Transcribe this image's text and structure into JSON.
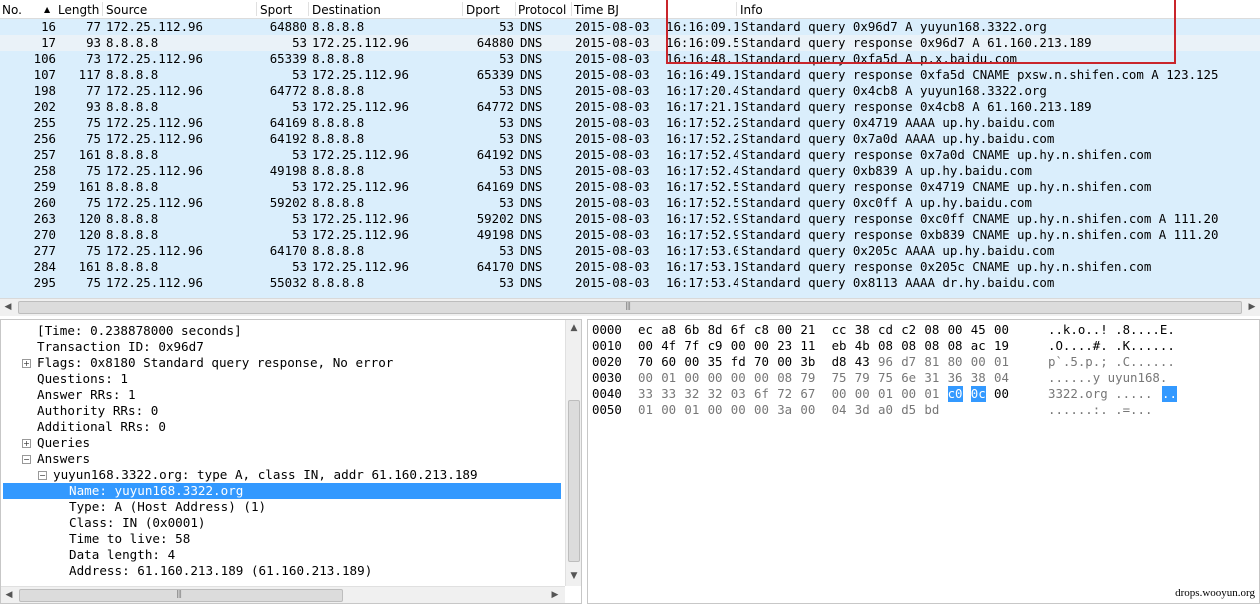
{
  "columns": [
    "No.",
    "Length",
    "Source",
    "Sport",
    "Destination",
    "Dport",
    "Protocol",
    "Time BJ",
    "Info"
  ],
  "packets": [
    {
      "no": "16",
      "len": "77",
      "src": "172.25.112.96",
      "sport": "64880",
      "dst": "8.8.8.8",
      "dport": "53",
      "proto": "DNS",
      "date": "2015-08-03",
      "time": "16:16:09.1",
      "info": "Standard query 0x96d7  A yuyun168.3322.org"
    },
    {
      "no": "17",
      "len": "93",
      "src": "8.8.8.8",
      "sport": "53",
      "dst": "172.25.112.96",
      "dport": "64880",
      "proto": "DNS",
      "date": "2015-08-03",
      "time": "16:16:09.5",
      "info": "Standard query response 0x96d7  A 61.160.213.189",
      "selected": true
    },
    {
      "no": "106",
      "len": "73",
      "src": "172.25.112.96",
      "sport": "65339",
      "dst": "8.8.8.8",
      "dport": "53",
      "proto": "DNS",
      "date": "2015-08-03",
      "time": "16:16:48.1",
      "info": "Standard query 0xfa5d  A p.x.baidu.com"
    },
    {
      "no": "107",
      "len": "117",
      "src": "8.8.8.8",
      "sport": "53",
      "dst": "172.25.112.96",
      "dport": "65339",
      "proto": "DNS",
      "date": "2015-08-03",
      "time": "16:16:49.1",
      "info": "Standard query response 0xfa5d  CNAME pxsw.n.shifen.com A 123.125"
    },
    {
      "no": "198",
      "len": "77",
      "src": "172.25.112.96",
      "sport": "64772",
      "dst": "8.8.8.8",
      "dport": "53",
      "proto": "DNS",
      "date": "2015-08-03",
      "time": "16:17:20.4",
      "info": "Standard query 0x4cb8  A yuyun168.3322.org"
    },
    {
      "no": "202",
      "len": "93",
      "src": "8.8.8.8",
      "sport": "53",
      "dst": "172.25.112.96",
      "dport": "64772",
      "proto": "DNS",
      "date": "2015-08-03",
      "time": "16:17:21.1",
      "info": "Standard query response 0x4cb8  A 61.160.213.189"
    },
    {
      "no": "255",
      "len": "75",
      "src": "172.25.112.96",
      "sport": "64169",
      "dst": "8.8.8.8",
      "dport": "53",
      "proto": "DNS",
      "date": "2015-08-03",
      "time": "16:17:52.2",
      "info": "Standard query 0x4719  AAAA up.hy.baidu.com"
    },
    {
      "no": "256",
      "len": "75",
      "src": "172.25.112.96",
      "sport": "64192",
      "dst": "8.8.8.8",
      "dport": "53",
      "proto": "DNS",
      "date": "2015-08-03",
      "time": "16:17:52.2",
      "info": "Standard query 0x7a0d  AAAA up.hy.baidu.com"
    },
    {
      "no": "257",
      "len": "161",
      "src": "8.8.8.8",
      "sport": "53",
      "dst": "172.25.112.96",
      "dport": "64192",
      "proto": "DNS",
      "date": "2015-08-03",
      "time": "16:17:52.4",
      "info": "Standard query response 0x7a0d  CNAME up.hy.n.shifen.com"
    },
    {
      "no": "258",
      "len": "75",
      "src": "172.25.112.96",
      "sport": "49198",
      "dst": "8.8.8.8",
      "dport": "53",
      "proto": "DNS",
      "date": "2015-08-03",
      "time": "16:17:52.4",
      "info": "Standard query 0xb839  A up.hy.baidu.com"
    },
    {
      "no": "259",
      "len": "161",
      "src": "8.8.8.8",
      "sport": "53",
      "dst": "172.25.112.96",
      "dport": "64169",
      "proto": "DNS",
      "date": "2015-08-03",
      "time": "16:17:52.5",
      "info": "Standard query response 0x4719  CNAME up.hy.n.shifen.com"
    },
    {
      "no": "260",
      "len": "75",
      "src": "172.25.112.96",
      "sport": "59202",
      "dst": "8.8.8.8",
      "dport": "53",
      "proto": "DNS",
      "date": "2015-08-03",
      "time": "16:17:52.5",
      "info": "Standard query 0xc0ff  A up.hy.baidu.com"
    },
    {
      "no": "263",
      "len": "120",
      "src": "8.8.8.8",
      "sport": "53",
      "dst": "172.25.112.96",
      "dport": "59202",
      "proto": "DNS",
      "date": "2015-08-03",
      "time": "16:17:52.9",
      "info": "Standard query response 0xc0ff  CNAME up.hy.n.shifen.com A 111.20"
    },
    {
      "no": "270",
      "len": "120",
      "src": "8.8.8.8",
      "sport": "53",
      "dst": "172.25.112.96",
      "dport": "49198",
      "proto": "DNS",
      "date": "2015-08-03",
      "time": "16:17:52.9",
      "info": "Standard query response 0xb839  CNAME up.hy.n.shifen.com A 111.20"
    },
    {
      "no": "277",
      "len": "75",
      "src": "172.25.112.96",
      "sport": "64170",
      "dst": "8.8.8.8",
      "dport": "53",
      "proto": "DNS",
      "date": "2015-08-03",
      "time": "16:17:53.0",
      "info": "Standard query 0x205c  AAAA up.hy.baidu.com"
    },
    {
      "no": "284",
      "len": "161",
      "src": "8.8.8.8",
      "sport": "53",
      "dst": "172.25.112.96",
      "dport": "64170",
      "proto": "DNS",
      "date": "2015-08-03",
      "time": "16:17:53.1",
      "info": "Standard query response 0x205c  CNAME up.hy.n.shifen.com"
    },
    {
      "no": "295",
      "len": "75",
      "src": "172.25.112.96",
      "sport": "55032",
      "dst": "8.8.8.8",
      "dport": "53",
      "proto": "DNS",
      "date": "2015-08-03",
      "time": "16:17:53.4",
      "info": "Standard query 0x8113  AAAA dr.hy.baidu.com"
    }
  ],
  "details": [
    {
      "text": "[Time: 0.238878000 seconds]",
      "level": 1,
      "exp": ""
    },
    {
      "text": "Transaction ID: 0x96d7",
      "level": 1,
      "exp": ""
    },
    {
      "text": "Flags: 0x8180 Standard query response, No error",
      "level": 1,
      "exp": "+"
    },
    {
      "text": "Questions: 1",
      "level": 1,
      "exp": ""
    },
    {
      "text": "Answer RRs: 1",
      "level": 1,
      "exp": ""
    },
    {
      "text": "Authority RRs: 0",
      "level": 1,
      "exp": ""
    },
    {
      "text": "Additional RRs: 0",
      "level": 1,
      "exp": ""
    },
    {
      "text": "Queries",
      "level": 1,
      "exp": "+"
    },
    {
      "text": "Answers",
      "level": 1,
      "exp": "-"
    },
    {
      "text": "yuyun168.3322.org: type A, class IN, addr 61.160.213.189",
      "level": 2,
      "exp": "-"
    },
    {
      "text": "Name: yuyun168.3322.org",
      "level": 3,
      "exp": "",
      "selected": true
    },
    {
      "text": "Type: A (Host Address) (1)",
      "level": 3,
      "exp": ""
    },
    {
      "text": "Class: IN (0x0001)",
      "level": 3,
      "exp": ""
    },
    {
      "text": "Time to live: 58",
      "level": 3,
      "exp": ""
    },
    {
      "text": "Data length: 4",
      "level": 3,
      "exp": ""
    },
    {
      "text": "Address: 61.160.213.189 (61.160.213.189)",
      "level": 3,
      "exp": ""
    }
  ],
  "bytes": [
    {
      "offset": "0000",
      "hex": [
        "ec",
        "a8",
        "6b",
        "8d",
        "6f",
        "c8",
        "00",
        "21",
        "cc",
        "38",
        "cd",
        "c2",
        "08",
        "00",
        "45",
        "00"
      ],
      "ascii": "..k.o..! .8....E.",
      "grey": [],
      "hl": []
    },
    {
      "offset": "0010",
      "hex": [
        "00",
        "4f",
        "7f",
        "c9",
        "00",
        "00",
        "23",
        "11",
        "eb",
        "4b",
        "08",
        "08",
        "08",
        "08",
        "ac",
        "19"
      ],
      "ascii": ".O....#. .K......",
      "grey": [],
      "hl": []
    },
    {
      "offset": "0020",
      "hex": [
        "70",
        "60",
        "00",
        "35",
        "fd",
        "70",
        "00",
        "3b",
        "d8",
        "43",
        "96",
        "d7",
        "81",
        "80",
        "00",
        "01"
      ],
      "ascii": "p`.5.p.; .C......",
      "grey": [
        10,
        11,
        12,
        13,
        14,
        15
      ],
      "hl": []
    },
    {
      "offset": "0030",
      "hex": [
        "00",
        "01",
        "00",
        "00",
        "00",
        "00",
        "08",
        "79",
        "75",
        "79",
        "75",
        "6e",
        "31",
        "36",
        "38",
        "04"
      ],
      "ascii": "......y uyun168.",
      "grey": [
        0,
        1,
        2,
        3,
        4,
        5,
        6,
        7,
        8,
        9,
        10,
        11,
        12,
        13,
        14,
        15
      ],
      "hl": []
    },
    {
      "offset": "0040",
      "hex": [
        "33",
        "33",
        "32",
        "32",
        "03",
        "6f",
        "72",
        "67",
        "00",
        "00",
        "01",
        "00",
        "01",
        "c0",
        "0c",
        "00"
      ],
      "ascii": "3322.org .....",
      "asciiHl": "..",
      "grey": [
        0,
        1,
        2,
        3,
        4,
        5,
        6,
        7,
        8,
        9,
        10,
        11,
        12
      ],
      "hl": [
        13,
        14
      ]
    },
    {
      "offset": "0050",
      "hex": [
        "01",
        "00",
        "01",
        "00",
        "00",
        "00",
        "3a",
        "00",
        "04",
        "3d",
        "a0",
        "d5",
        "bd"
      ],
      "ascii": "......:. .=...",
      "grey": [
        0,
        1,
        2,
        3,
        4,
        5,
        6,
        7,
        8,
        9,
        10,
        11,
        12
      ],
      "hl": []
    }
  ],
  "watermark": "drops.wooyun.org",
  "colors": {
    "rowBg": "#daeefc",
    "selected": "#3399ff",
    "redBox": "#c9252b"
  }
}
